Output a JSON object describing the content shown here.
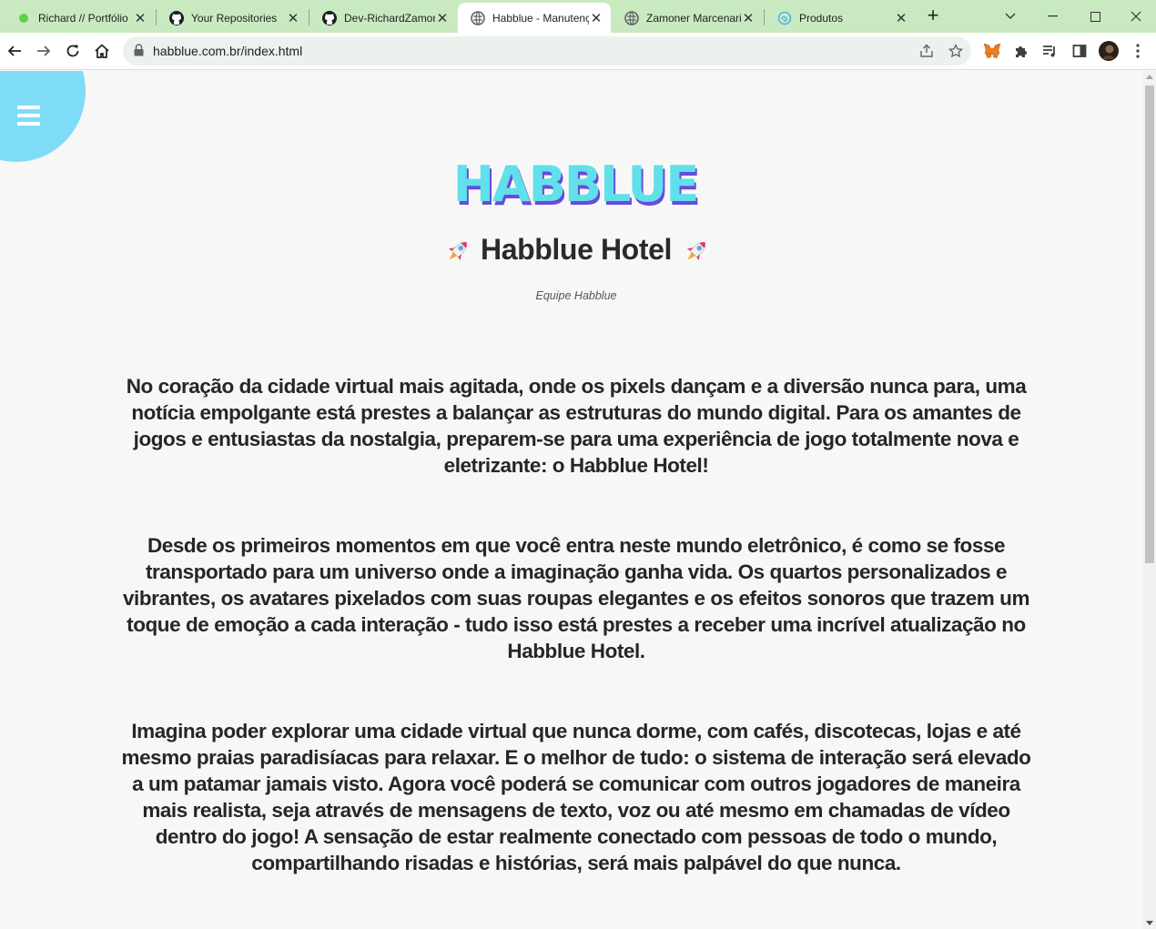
{
  "browser": {
    "tabs": [
      {
        "title": "Richard // Portfólio",
        "icon": "green-dot-icon"
      },
      {
        "title": "Your Repositories",
        "icon": "github-icon"
      },
      {
        "title": "Dev-RichardZamoner",
        "icon": "github-icon"
      },
      {
        "title": "Habblue - Manutenção",
        "icon": "globe-icon"
      },
      {
        "title": "Zamoner Marcenaria",
        "icon": "globe-icon"
      },
      {
        "title": "Produtos",
        "icon": "swirl-icon"
      }
    ],
    "active_tab": 3,
    "url": "habblue.com.br/index.html",
    "colors": {
      "tabstrip": "#c9eac0",
      "toolbar": "#ffffff",
      "omnibox": "#edf1ee"
    }
  },
  "page": {
    "logo_text": "HABBLUE",
    "headline": "Habblue Hotel",
    "byline": "Equipe Habblue",
    "paragraphs": [
      "No coração da cidade virtual mais agitada, onde os pixels dançam e a diversão nunca para, uma notícia empolgante está prestes a balançar as estruturas do mundo digital. Para os amantes de jogos e entusiastas da nostalgia, preparem-se para uma experiência de jogo totalmente nova e eletrizante: o Habblue Hotel!",
      "Desde os primeiros momentos em que você entra neste mundo eletrônico, é como se fosse transportado para um universo onde a imaginação ganha vida. Os quartos personalizados e vibrantes, os avatares pixelados com suas roupas elegantes e os efeitos sonoros que trazem um toque de emoção a cada interação - tudo isso está prestes a receber uma incrível atualização no Habblue Hotel.",
      "Imagina poder explorar uma cidade virtual que nunca dorme, com cafés, discotecas, lojas e até mesmo praias paradisíacas para relaxar. E o melhor de tudo: o sistema de interação será elevado a um patamar jamais visto. Agora você poderá se comunicar com outros jogadores de maneira mais realista, seja através de mensagens de texto, voz ou até mesmo em chamadas de vídeo dentro do jogo! A sensação de estar realmente conectado com pessoas de todo o mundo, compartilhando risadas e histórias, será mais palpável do que nunca."
    ],
    "colors": {
      "menu_blob": "#7fdcf6",
      "logo_fill": "#5fe0ea",
      "logo_shadow": "#6a4ad8",
      "text": "#262626"
    }
  }
}
